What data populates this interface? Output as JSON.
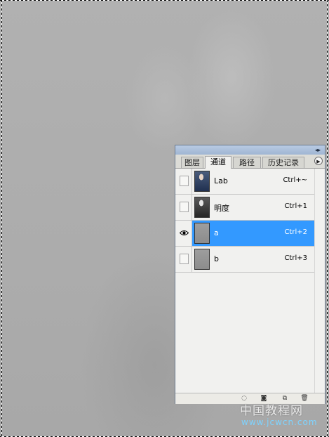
{
  "panel": {
    "collapse_icon": "double-arrow-icon",
    "menu_icon": "play-arrow-icon",
    "tabs": [
      {
        "label": "图层"
      },
      {
        "label": "通道"
      },
      {
        "label": "路径"
      },
      {
        "label": "历史记录"
      }
    ],
    "active_tab": "通道",
    "channels": [
      {
        "name": "Lab",
        "shortcut": "Ctrl+~",
        "visible": false,
        "selected": false
      },
      {
        "name": "明度",
        "shortcut": "Ctrl+1",
        "visible": false,
        "selected": false
      },
      {
        "name": "a",
        "shortcut": "Ctrl+2",
        "visible": true,
        "selected": true
      },
      {
        "name": "b",
        "shortcut": "Ctrl+3",
        "visible": false,
        "selected": false
      }
    ],
    "bottom_buttons": [
      {
        "icon": "load-selection-icon"
      },
      {
        "icon": "save-selection-icon"
      },
      {
        "icon": "new-channel-icon"
      },
      {
        "icon": "trash-icon"
      }
    ],
    "colors": {
      "selected_row": "#3399ff",
      "titlebar": "#9fb5d3"
    }
  },
  "watermark": {
    "brand": "中国教程网",
    "url": "www.jcwcn.com"
  }
}
